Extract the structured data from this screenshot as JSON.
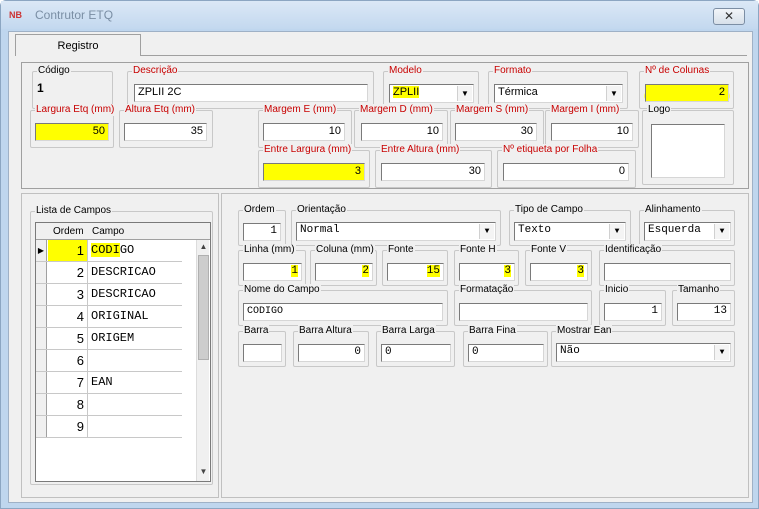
{
  "window": {
    "app_icon": "ETQ-app-icon",
    "title": "Contrutor ETQ",
    "close_glyph": "✕"
  },
  "tabs": [
    {
      "label": "Registro"
    }
  ],
  "header": {
    "codigo": {
      "label": "Código",
      "value": "1"
    },
    "descricao": {
      "label": "Descrição",
      "value": "ZPLII 2C"
    },
    "modelo": {
      "label": "Modelo",
      "value": "ZPLII"
    },
    "formato": {
      "label": "Formato",
      "value": "Térmica"
    },
    "n_colunas": {
      "label": "Nº de Colunas",
      "value": "2"
    },
    "largura_etq": {
      "label": "Largura Etq (mm)",
      "value": "50"
    },
    "altura_etq": {
      "label": "Altura Etq (mm)",
      "value": "35"
    },
    "margem_e": {
      "label": "Margem E (mm)",
      "value": "10"
    },
    "margem_d": {
      "label": "Margem D (mm)",
      "value": "10"
    },
    "margem_s": {
      "label": "Margem S (mm)",
      "value": "30"
    },
    "margem_i": {
      "label": "Margem I (mm)",
      "value": "10"
    },
    "logo": {
      "label": "Logo"
    },
    "entre_largura": {
      "label": "Entre Largura (mm)",
      "value": "3"
    },
    "entre_altura": {
      "label": "Entre Altura (mm)",
      "value": "30"
    },
    "n_etiqueta_folha": {
      "label": "Nº etiqueta por Folha",
      "value": "0"
    }
  },
  "campos": {
    "title": "Lista de Campos",
    "col_ordem": "Ordem",
    "col_campo": "Campo",
    "rows": [
      {
        "ordem": "1",
        "campo": "CODIGO"
      },
      {
        "ordem": "2",
        "campo": "DESCRICAO"
      },
      {
        "ordem": "3",
        "campo": "DESCRICAO"
      },
      {
        "ordem": "4",
        "campo": "ORIGINAL"
      },
      {
        "ordem": "5",
        "campo": "ORIGEM"
      },
      {
        "ordem": "6",
        "campo": ""
      },
      {
        "ordem": "7",
        "campo": "EAN"
      },
      {
        "ordem": "8",
        "campo": ""
      },
      {
        "ordem": "9",
        "campo": ""
      }
    ]
  },
  "detail": {
    "ordem": {
      "label": "Ordem",
      "value": "1"
    },
    "orientacao": {
      "label": "Orientação",
      "value": "Normal"
    },
    "tipo_campo": {
      "label": "Tipo de Campo",
      "value": "Texto"
    },
    "alinhamento": {
      "label": "Alinhamento",
      "value": "Esquerda"
    },
    "linha": {
      "label": "Linha (mm)",
      "value": "1"
    },
    "coluna": {
      "label": "Coluna (mm)",
      "value": "2"
    },
    "fonte": {
      "label": "Fonte",
      "value": "15"
    },
    "fonte_h": {
      "label": "Fonte H",
      "value": "3"
    },
    "fonte_v": {
      "label": "Fonte V",
      "value": "3"
    },
    "identificacao": {
      "label": "Identificação",
      "value": ""
    },
    "nome_campo": {
      "label": "Nome do Campo",
      "value": "CODIGO"
    },
    "formatacao": {
      "label": "Formatação",
      "value": ""
    },
    "inicio": {
      "label": "Inicio",
      "value": "1"
    },
    "tamanho": {
      "label": "Tamanho",
      "value": "13"
    },
    "barra": {
      "label": "Barra",
      "value": ""
    },
    "barra_altura": {
      "label": "Barra Altura",
      "value": "0"
    },
    "barra_larga": {
      "label": "Barra Larga",
      "value": "0"
    },
    "barra_fina": {
      "label": "Barra Fina",
      "value": "0"
    },
    "mostrar_ean": {
      "label": "Mostrar Ean",
      "value": "Não"
    }
  },
  "icons": {
    "dropdown": "▼",
    "row_pointer": "▶",
    "scroll_up": "▲",
    "scroll_down": "▼"
  },
  "colors": {
    "highlight": "#ffff00",
    "required_label": "#c80000",
    "title_bar": "#c3d8ef"
  }
}
